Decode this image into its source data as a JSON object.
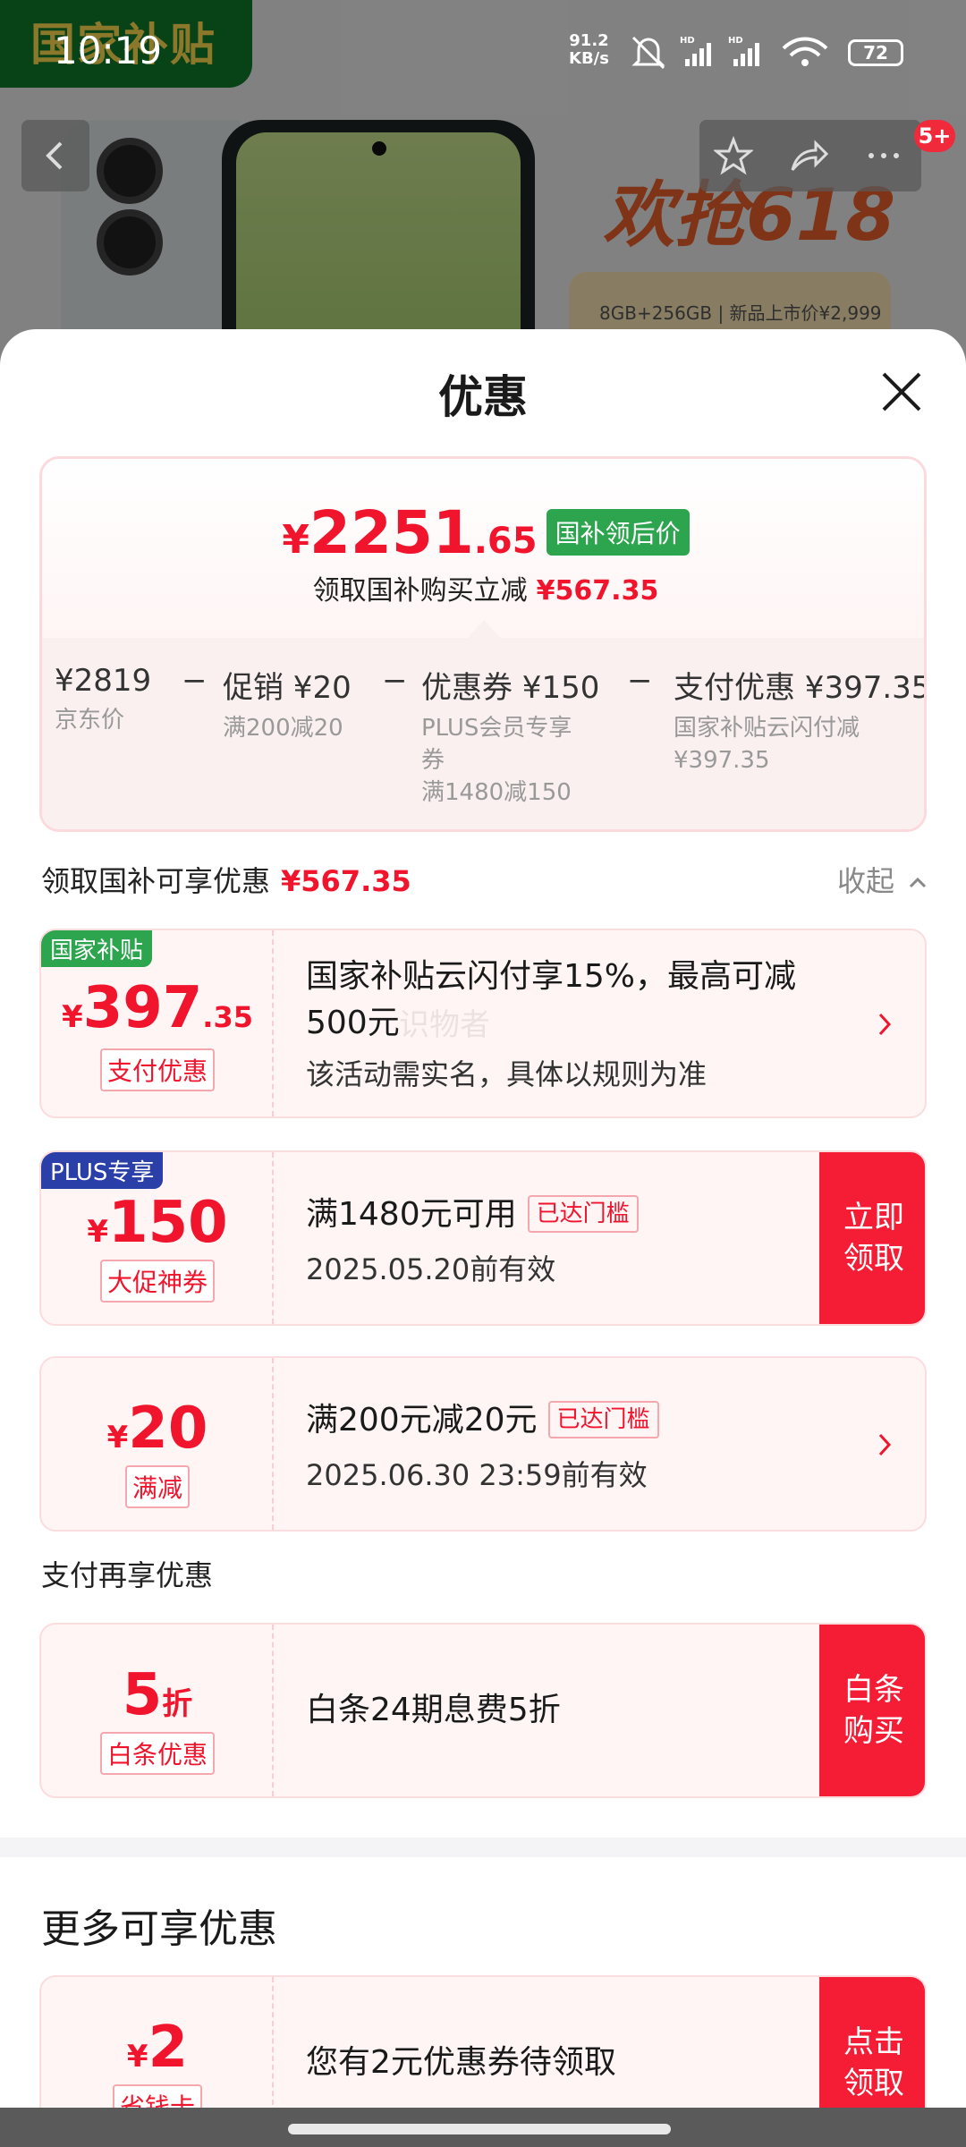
{
  "status_bar": {
    "time": "10:19",
    "net_speed_value": "91.2",
    "net_speed_unit": "KB/s",
    "battery": "72"
  },
  "background": {
    "subsidy_tag": "国家补贴",
    "promo_text": "欢抢618",
    "spec_text": "8GB+256GB | 新品上市价¥2,999",
    "cart_badge": "5+"
  },
  "sheet": {
    "title": "优惠",
    "summary": {
      "currency": "¥",
      "price_int": "2251",
      "price_dec": ".65",
      "price_tag": "国补领后价",
      "sub_text": "领取国补购买立减",
      "sub_amount": "¥567.35",
      "minus": "−",
      "breakdown": [
        {
          "title": "¥2819",
          "sub": [
            "京东价"
          ]
        },
        {
          "title": "促销 ¥20",
          "sub": [
            "满200减20"
          ]
        },
        {
          "title": "优惠券 ¥150",
          "sub": [
            "PLUS会员专享",
            "券",
            "满1480减150"
          ]
        },
        {
          "title": "支付优惠 ¥397.35",
          "sub": [
            "国家补贴云闪付减",
            "¥397.35"
          ]
        }
      ]
    },
    "section1": {
      "label": "领取国补可享优惠",
      "amount": "¥567.35",
      "collapse": "收起"
    },
    "coupons": [
      {
        "corner": "国家补贴",
        "currency": "¥",
        "int": "397",
        "dec": ".35",
        "label": "支付优惠",
        "line1": "国家补贴云闪付享15%，最高可减",
        "line2": "500元",
        "sub": "该活动需实名，具体以规则为准"
      },
      {
        "corner": "PLUS专享",
        "currency": "¥",
        "int": "150",
        "label": "大促神券",
        "line1": "满1480元可用",
        "threshold": "已达门槛",
        "sub": "2025.05.20前有效",
        "cta1": "立即",
        "cta2": "领取"
      },
      {
        "currency": "¥",
        "int": "20",
        "label": "满减",
        "line1": "满200元减20元",
        "threshold": "已达门槛",
        "sub": "2025.06.30 23:59前有效"
      }
    ],
    "section2": {
      "label": "支付再享优惠"
    },
    "baitiao": {
      "int": "5",
      "unit": "折",
      "label": "白条优惠",
      "text": "白条24期息费5折",
      "cta1": "白条",
      "cta2": "购买"
    },
    "more_title": "更多可享优惠",
    "more_coupon": {
      "currency": "¥",
      "int": "2",
      "label": "省钱卡",
      "text": "您有2元优惠券待领取",
      "cta1": "点击",
      "cta2": "领取"
    },
    "watermark": "识物者"
  },
  "colors": {
    "accent_red": "#f0152d",
    "cta_red": "#f51d35",
    "subsidy_green": "#2da44e",
    "plus_blue": "#2b3fa8"
  }
}
